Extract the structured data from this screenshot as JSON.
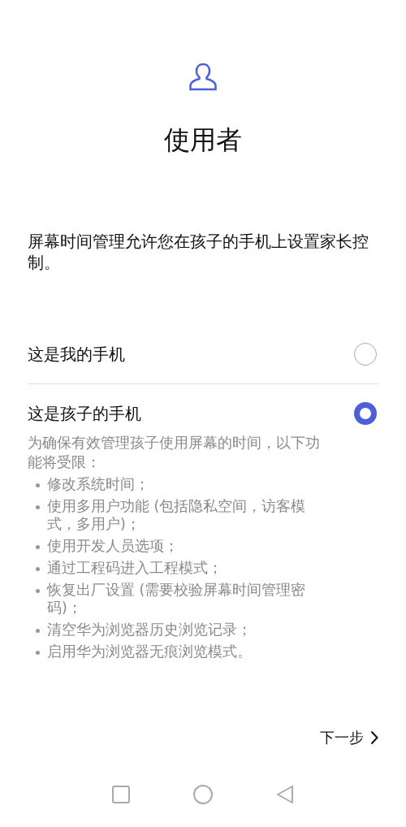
{
  "title": "使用者",
  "description": "屏幕时间管理允许您在孩子的手机上设置家长控制。",
  "options": [
    {
      "label": "这是我的手机",
      "selected": false
    },
    {
      "label": "这是孩子的手机",
      "selected": true,
      "note": "为确保有效管理孩子使用屏幕的时间，以下功能将受限：",
      "restrictions": [
        "修改系统时间；",
        "使用多用户功能 (包括隐私空间，访客模式，多用户)；",
        "使用开发人员选项；",
        "通过工程码进入工程模式；",
        "恢复出厂设置 (需要校验屏幕时间管理密码)；",
        "清空华为浏览器历史浏览记录；",
        "启用华为浏览器无痕浏览模式。"
      ]
    }
  ],
  "next_button": "下一步"
}
